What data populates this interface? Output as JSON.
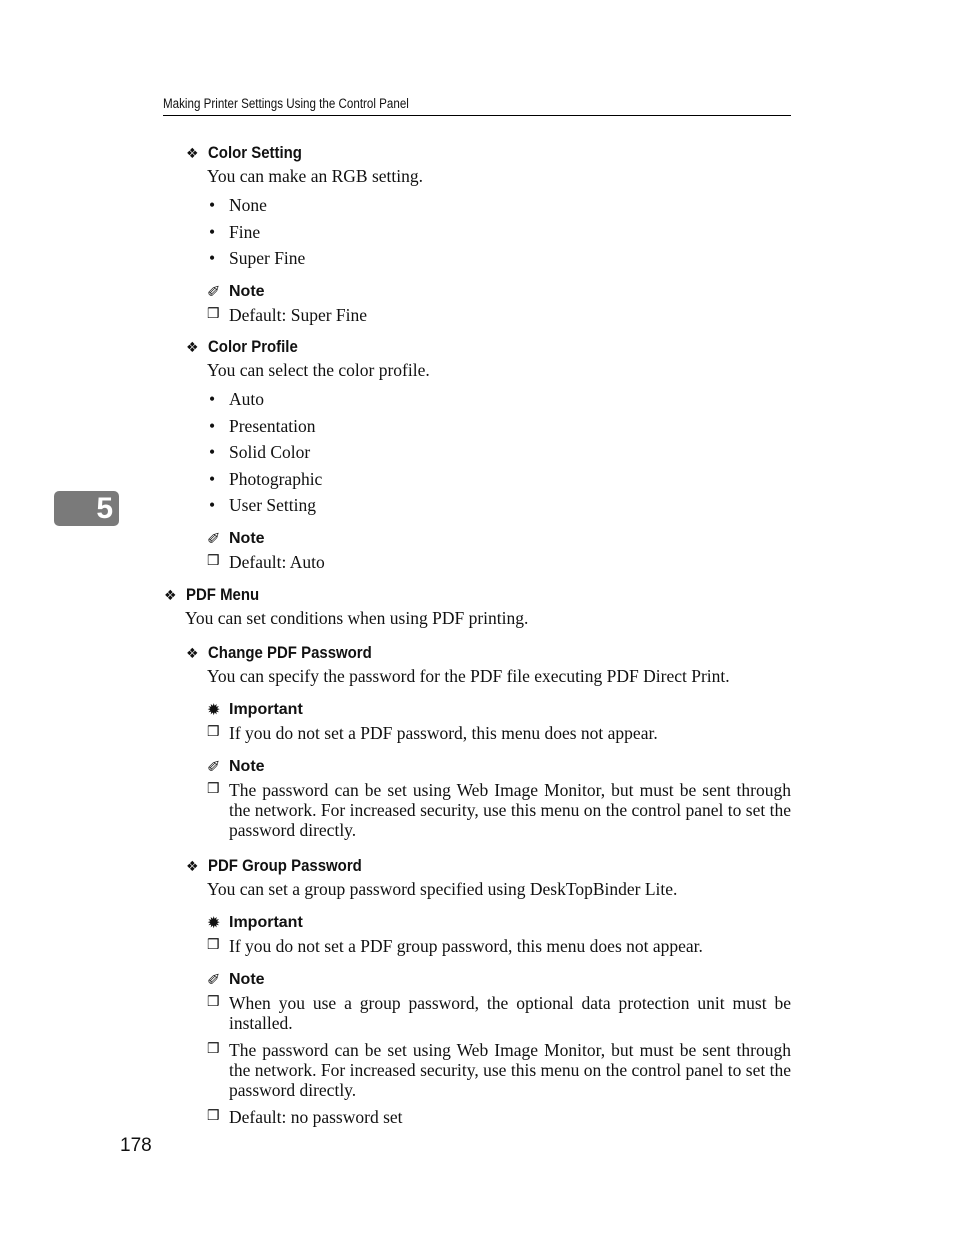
{
  "running_head": "Making Printer Settings Using the Control Panel",
  "chapter_tab": "5",
  "page_number": "178",
  "icons": {
    "section_marker": "diamond-bullet-icon",
    "note": "pencil-icon",
    "important": "important-burst-icon",
    "bullet": "bullet-dot-icon",
    "checkbox": "checkbox-icon"
  },
  "sections": {
    "color_setting": {
      "title": "Color Setting",
      "description": "You can make an RGB setting.",
      "options": [
        "None",
        "Fine",
        "Super Fine"
      ],
      "note_label": "Note",
      "notes": [
        "Default: Super Fine"
      ]
    },
    "color_profile": {
      "title": "Color Profile",
      "description": "You can select the color profile.",
      "options": [
        "Auto",
        "Presentation",
        "Solid Color",
        "Photographic",
        "User Setting"
      ],
      "note_label": "Note",
      "notes": [
        "Default: Auto"
      ]
    },
    "pdf_menu": {
      "title": "PDF Menu",
      "description": "You can set conditions when using PDF printing."
    },
    "change_pdf_password": {
      "title": "Change PDF Password",
      "description": "You can specify the password for the PDF file executing PDF Direct Print.",
      "important_label": "Important",
      "important": [
        "If you do not set a PDF password, this menu does not appear."
      ],
      "note_label": "Note",
      "notes": [
        "The password can be set using Web Image Monitor, but must be sent through the network. For increased security, use this menu on the control panel to set the password directly."
      ]
    },
    "pdf_group_password": {
      "title": "PDF Group Password",
      "description": "You can set a group password specified using DeskTopBinder Lite.",
      "important_label": "Important",
      "important": [
        "If you do not set a PDF group password, this menu does not appear."
      ],
      "note_label": "Note",
      "notes": [
        "When you use a group password, the optional data protection unit must be installed.",
        "The password can be set using Web Image Monitor, but must be sent through the network. For increased security, use this menu on the control panel to set the password directly.",
        "Default: no password set"
      ]
    }
  }
}
